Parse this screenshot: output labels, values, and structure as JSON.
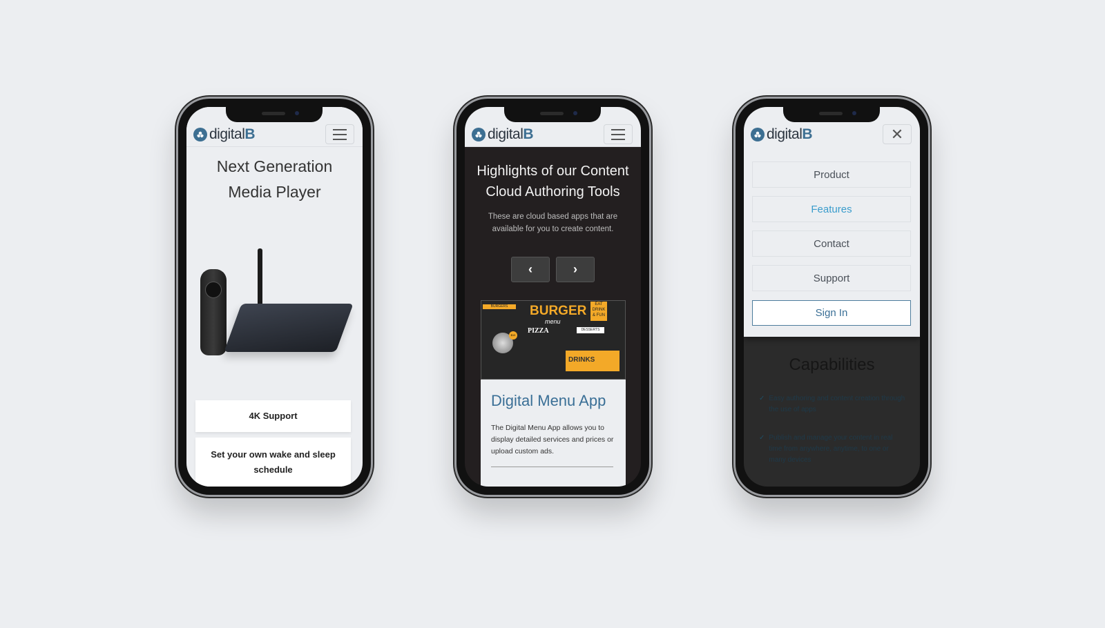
{
  "brand": {
    "logo_text_a": "digital",
    "logo_text_b": "B",
    "accent": "#3d6f92"
  },
  "phone1": {
    "title_line1": "Next Generation",
    "title_line2": "Media Player",
    "cards": [
      "4K Support",
      "Set your own wake and sleep schedule"
    ]
  },
  "phone2": {
    "title_line1": "Highlights of our Content",
    "title_line2": "Cloud Authoring Tools",
    "subtitle_line1": "These are cloud based apps that are",
    "subtitle_line2": "available for you to create content.",
    "prev_icon": "chevron-left-icon",
    "next_icon": "chevron-right-icon",
    "menu_image": {
      "burgers": "BURGERS",
      "title": "BURGER",
      "subtitle": "menu",
      "pizza": "PIZZA",
      "desserts": "DESSERTS",
      "drinks": "DRINKS",
      "badge": "EAT DRINK & FUN",
      "price": "$10"
    },
    "card_title": "Digital Menu App",
    "card_text": "The Digital Menu App allows you to display detailed services and prices or upload custom ads."
  },
  "phone3": {
    "nav": [
      "Product",
      "Features",
      "Contact",
      "Support"
    ],
    "active_nav": "Features",
    "sign_in": "Sign In",
    "section_title": "Capabilities",
    "capabilities": [
      "Easy authoring and content creation through the use of apps",
      "Publish and manage your content in real time from anywhere, anytime, to one or many devices"
    ]
  }
}
